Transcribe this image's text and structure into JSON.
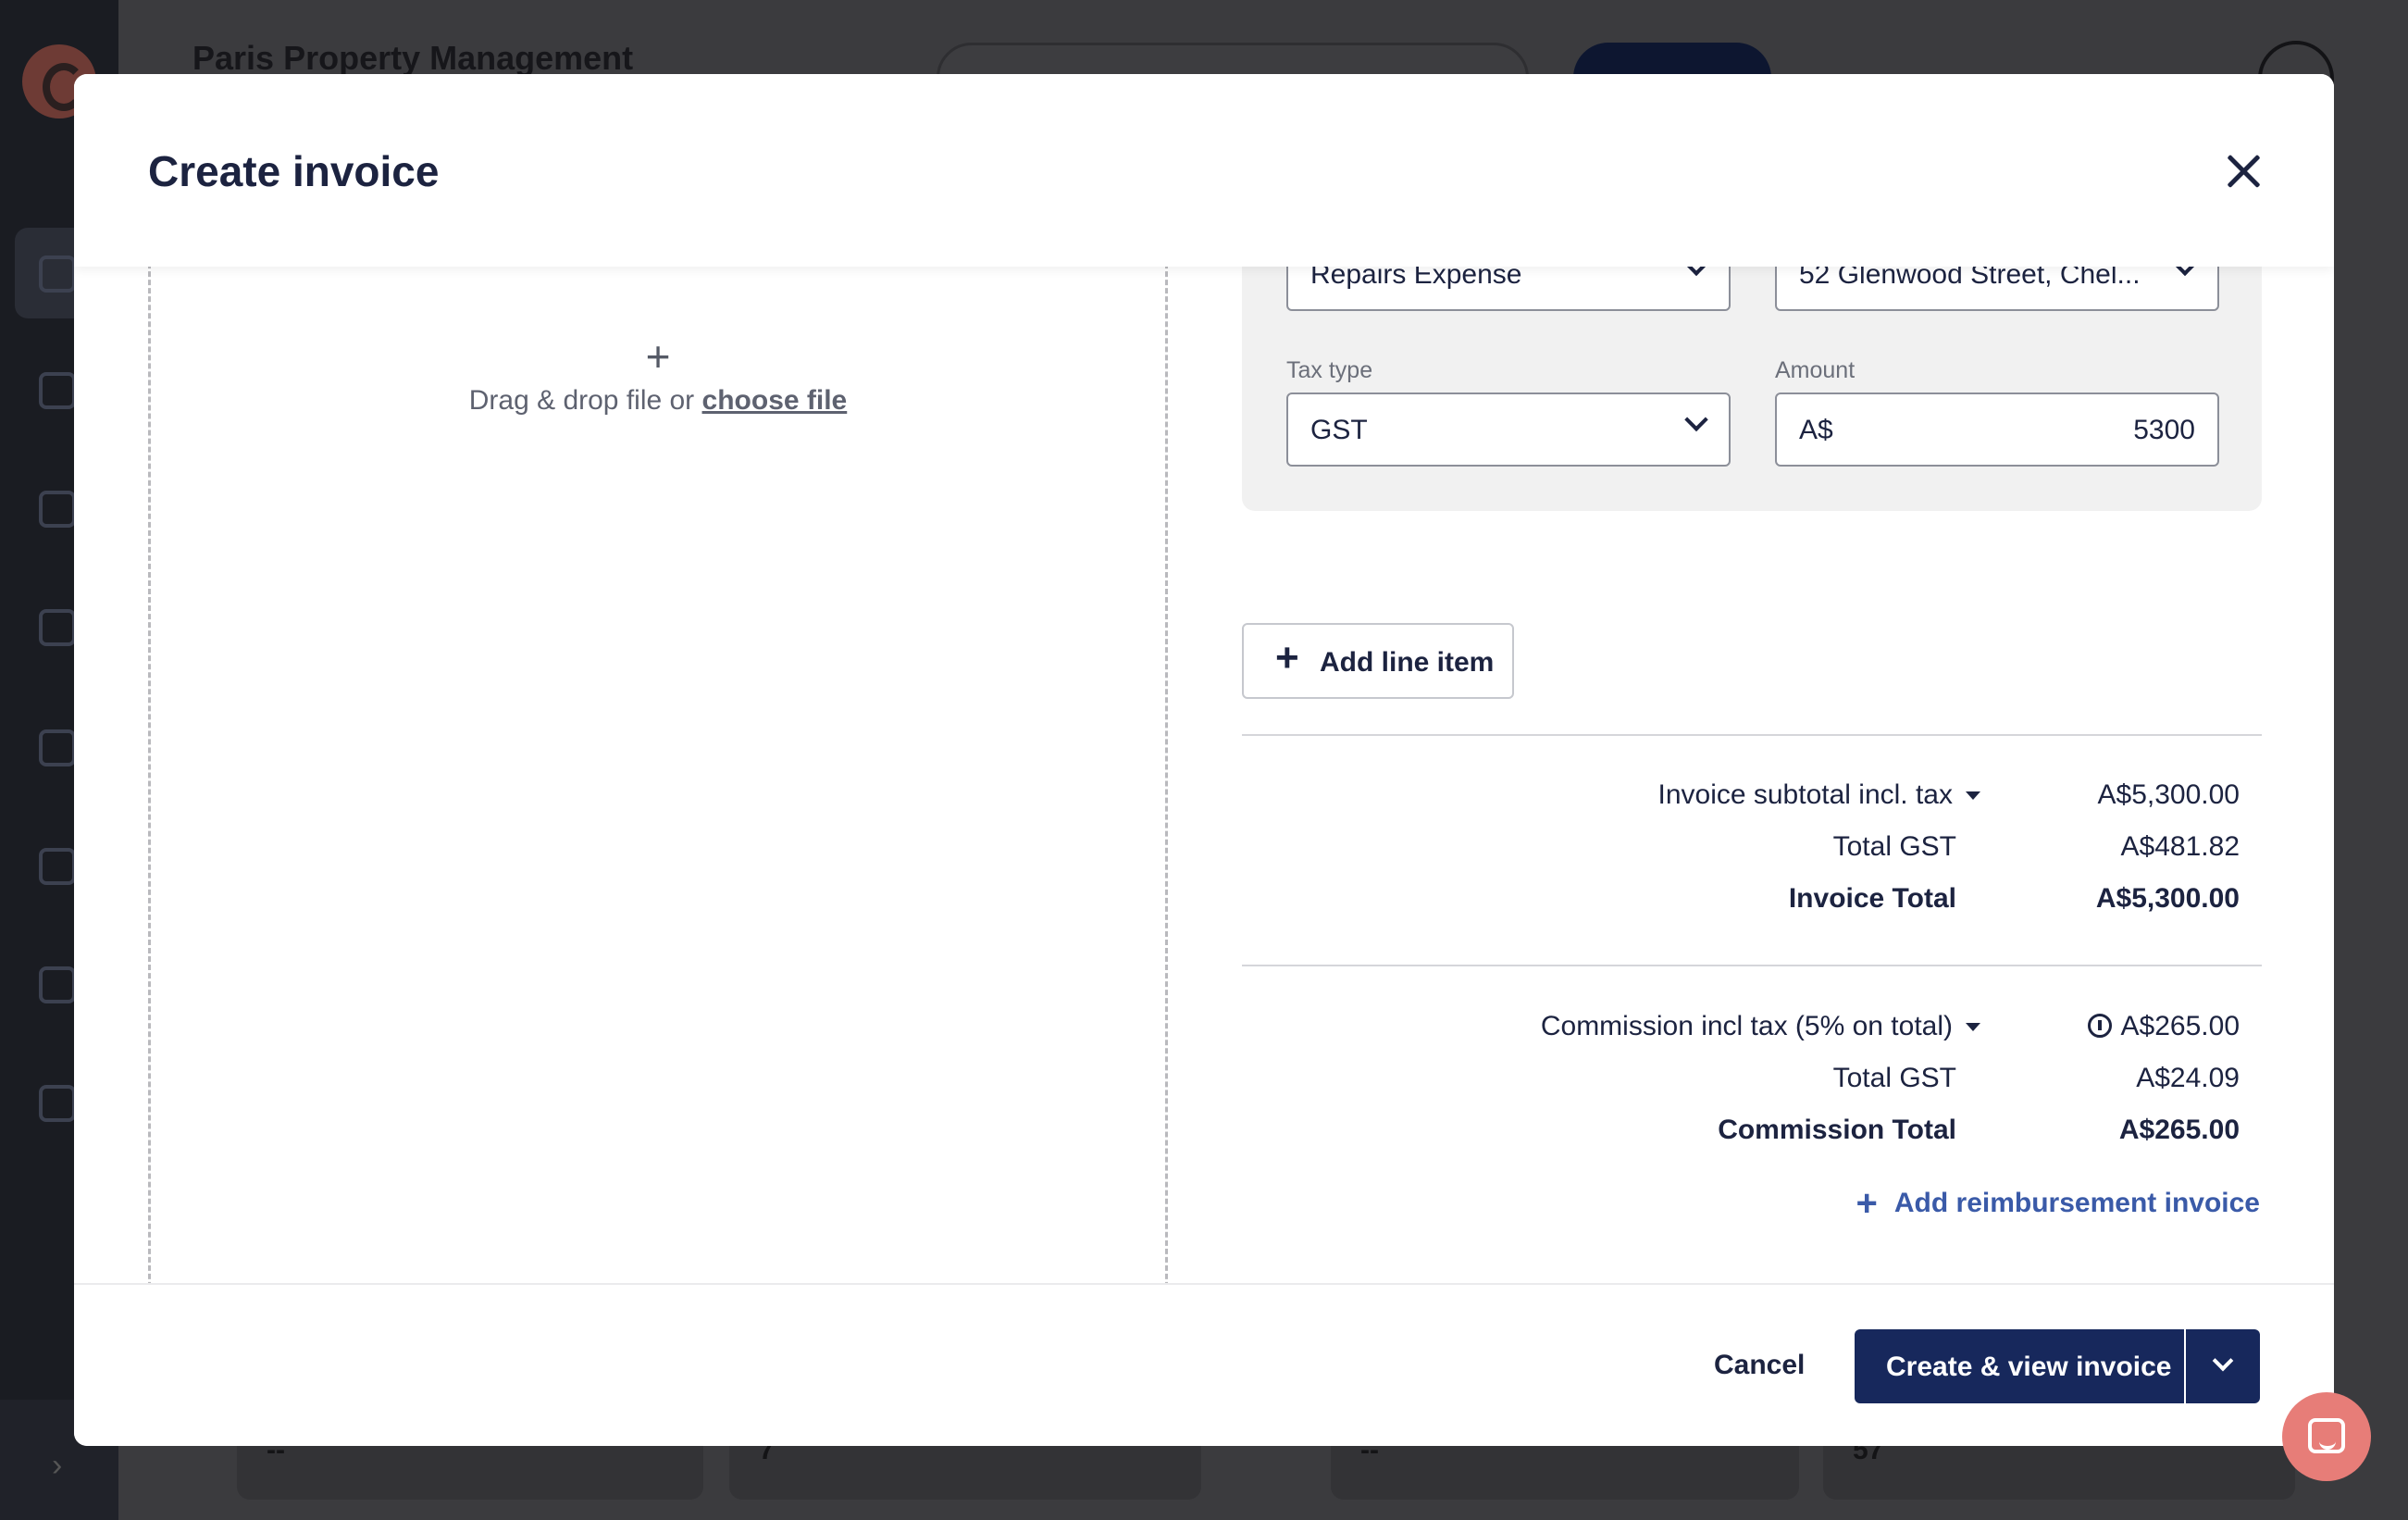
{
  "background_app": {
    "company_name": "Paris Property Management",
    "card_values": [
      "--",
      "7",
      "--",
      "57"
    ]
  },
  "modal": {
    "title": "Create invoice",
    "dropzone": {
      "text": "Drag & drop file or",
      "link": "choose file"
    },
    "line_item": {
      "account_value": "Repairs Expense",
      "property_value": "52 Glenwood Street, Chel...",
      "tax_type_label": "Tax type",
      "tax_type_value": "GST",
      "amount_label": "Amount",
      "amount_prefix": "A$",
      "amount_value": "5300"
    },
    "add_line_item_label": "Add line item",
    "summary": {
      "subtotal_label": "Invoice subtotal incl. tax",
      "subtotal_value": "A$5,300.00",
      "total_gst_label": "Total GST",
      "total_gst_value": "A$481.82",
      "invoice_total_label": "Invoice Total",
      "invoice_total_value": "A$5,300.00"
    },
    "commission": {
      "label": "Commission incl tax (5% on total)",
      "value": "A$265.00",
      "total_gst_label": "Total GST",
      "total_gst_value": "A$24.09",
      "total_label": "Commission Total",
      "total_value": "A$265.00"
    },
    "add_reimbursement_label": "Add reimbursement invoice",
    "footer": {
      "cancel_label": "Cancel",
      "create_label": "Create & view invoice"
    }
  },
  "colors": {
    "primary": "#17285c",
    "link": "#3a5aa8",
    "chat": "#e77d78"
  }
}
